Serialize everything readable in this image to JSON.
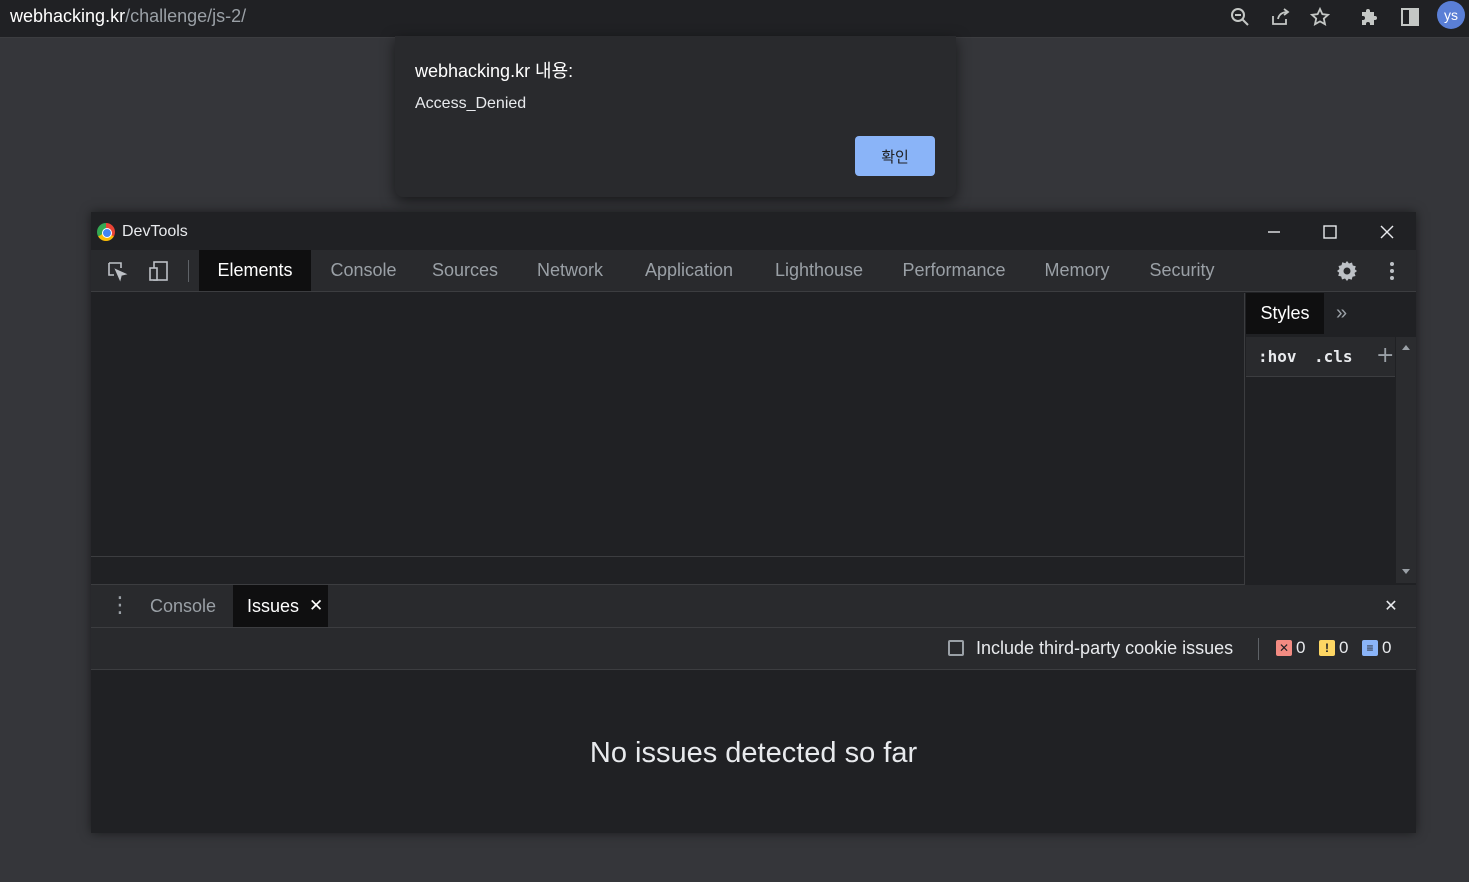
{
  "browser": {
    "url_host": "webhacking.kr",
    "url_path": "/challenge/js-2/",
    "avatar_initials": "ys",
    "toolbar_icons": [
      "zoom-icon",
      "share-icon",
      "star-icon",
      "extensions-icon",
      "side-panel-icon"
    ]
  },
  "alert": {
    "title": "webhacking.kr 내용:",
    "message": "Access_Denied",
    "ok_label": "확인"
  },
  "devtools": {
    "window_title": "DevTools",
    "tabs": [
      {
        "label": "Elements",
        "active": true
      },
      {
        "label": "Console",
        "active": false
      },
      {
        "label": "Sources",
        "active": false
      },
      {
        "label": "Network",
        "active": false
      },
      {
        "label": "Application",
        "active": false
      },
      {
        "label": "Lighthouse",
        "active": false
      },
      {
        "label": "Performance",
        "active": false
      },
      {
        "label": "Memory",
        "active": false
      },
      {
        "label": "Security",
        "active": false
      }
    ],
    "side_panel": {
      "styles_label": "Styles",
      "more_label": "»",
      "hov_label": ":hov",
      "cls_label": ".cls",
      "add_label": "+"
    },
    "drawer": {
      "tabs": [
        {
          "label": "Console",
          "active": false
        },
        {
          "label": "Issues",
          "active": true,
          "closable": true
        }
      ],
      "close_label": "✕"
    },
    "issues": {
      "checkbox_label": "Include third-party cookie issues",
      "checkbox_checked": false,
      "error_count": "0",
      "warning_count": "0",
      "info_count": "0",
      "empty_message": "No issues detected so far"
    }
  },
  "colors": {
    "accent_button": "#8ab4f8",
    "error": "#f28b82",
    "warning": "#fdd663",
    "info": "#8ab4f8"
  }
}
